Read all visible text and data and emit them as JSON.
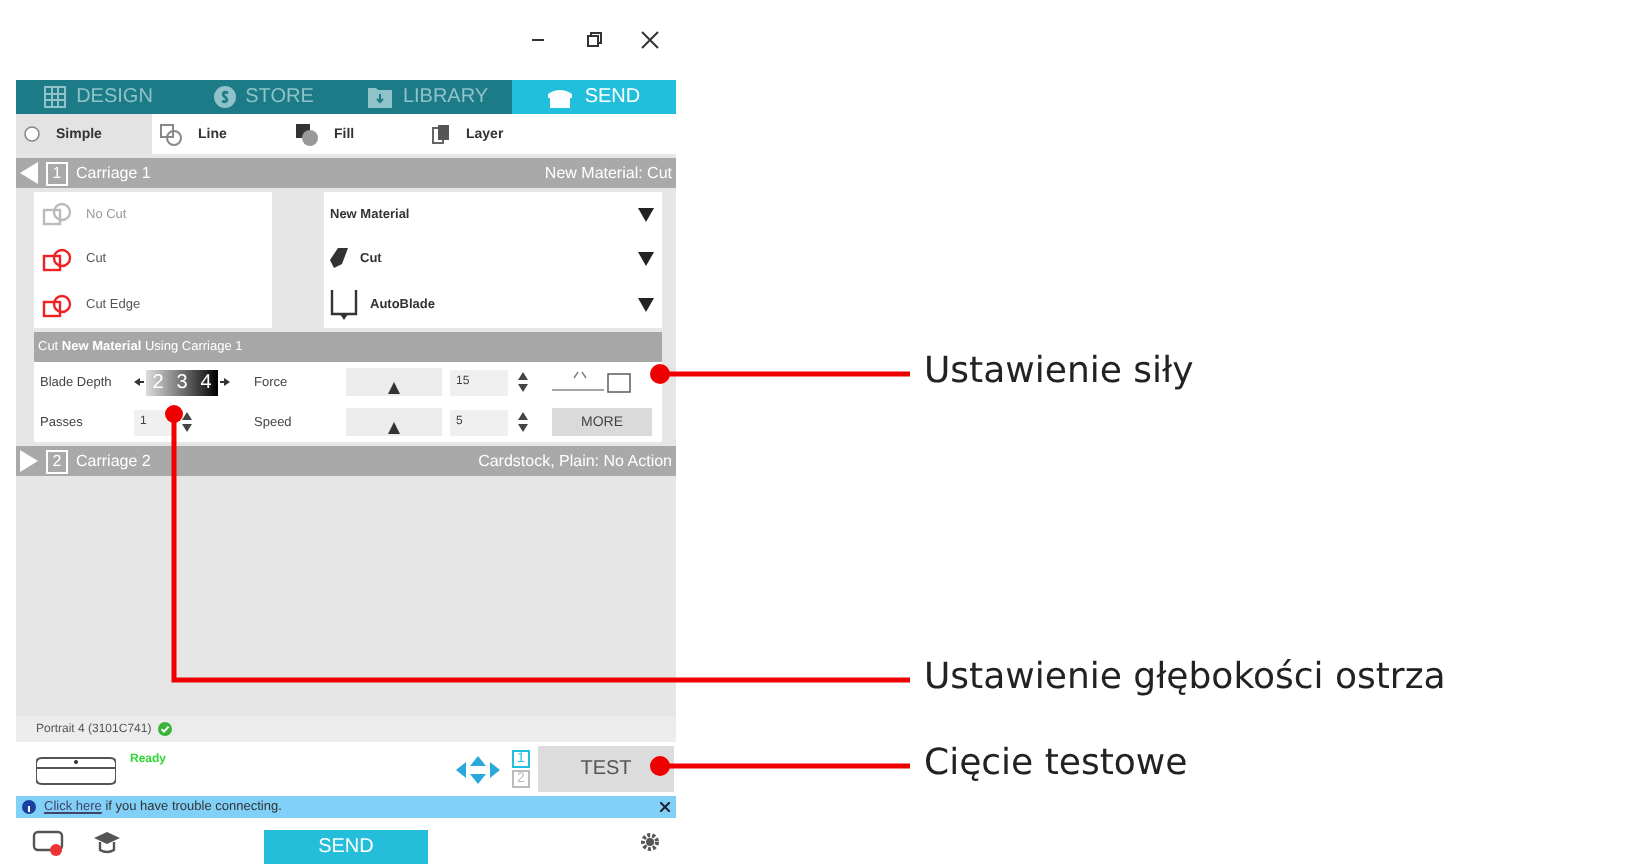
{
  "tabs": [
    {
      "label": "DESIGN",
      "kind": "grid",
      "selected": false
    },
    {
      "label": "STORE",
      "kind": "store",
      "selected": false
    },
    {
      "label": "LIBRARY",
      "kind": "folder",
      "selected": false
    },
    {
      "label": "SEND",
      "kind": "cutter",
      "selected": true
    }
  ],
  "modes": [
    {
      "label": "Simple",
      "kind": "radio",
      "selected": true
    },
    {
      "label": "Line",
      "kind": "line",
      "selected": false
    },
    {
      "label": "Fill",
      "kind": "fill",
      "selected": false
    },
    {
      "label": "Layer",
      "kind": "layer",
      "selected": false
    }
  ],
  "carriages": [
    {
      "number": "1",
      "title": "Carriage 1",
      "summary": "New Material: Cut",
      "expanded": true
    },
    {
      "number": "2",
      "title": "Carriage 2",
      "summary": "Cardstock, Plain: No Action",
      "expanded": false
    }
  ],
  "cut_options": [
    {
      "label": "No Cut",
      "disabled": true
    },
    {
      "label": "Cut",
      "disabled": false
    },
    {
      "label": "Cut Edge",
      "disabled": false
    }
  ],
  "dropdowns": [
    {
      "kind": "material",
      "value": "New Material"
    },
    {
      "kind": "action",
      "value": "Cut"
    },
    {
      "kind": "tool",
      "value": "AutoBlade"
    }
  ],
  "settings": {
    "heading": "Cut **New Material** Using Carriage 1",
    "blade_depth": {
      "label": "Blade Depth",
      "digits": [
        "2",
        "3",
        "4"
      ]
    },
    "passes": {
      "label": "Passes",
      "value": "1"
    },
    "force": {
      "label": "Force",
      "level": 0.5,
      "value": "15"
    },
    "speed": {
      "label": "Speed",
      "level": 0.5,
      "value": "5"
    },
    "more_button": "MORE"
  },
  "device": {
    "name": "Portrait 4  (3101C741)",
    "connected": true,
    "state": "Ready"
  },
  "carriage_selector": [
    {
      "label": "1",
      "selected": true
    },
    {
      "label": "2",
      "selected": false
    }
  ],
  "test_button": "TEST",
  "info_bar": {
    "link": "Click here",
    "text": " if you have trouble connecting."
  },
  "send_button": "SEND",
  "annotations": [
    {
      "label": "Ustawienie siły"
    },
    {
      "label": "Ustawienie głębokości ostrza"
    },
    {
      "label": "Cięcie testowe"
    }
  ]
}
